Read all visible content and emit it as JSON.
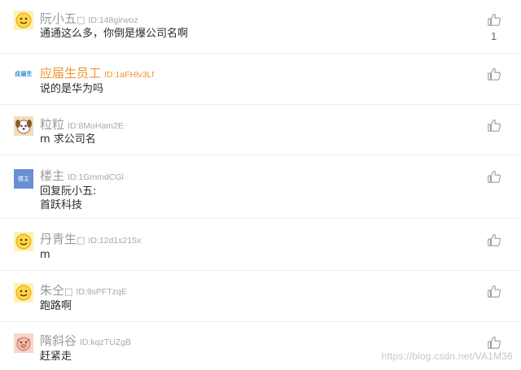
{
  "comments": [
    {
      "name": "阮小五",
      "name_suffix": "□",
      "id": "ID:148girwoz",
      "text": "通通这么多，你倒是爆公司名啊",
      "likes": "1",
      "avatar": "emoji-face-icon"
    },
    {
      "name": "应届生员工",
      "name_suffix": "",
      "id": "ID:1aFHlv3Lf",
      "text": "说的是华为吗",
      "likes": "",
      "avatar": "yingjiesheng-logo",
      "logo_text": "应届生"
    },
    {
      "name": "粒粒",
      "name_suffix": "",
      "id": "ID:8MoHam2E",
      "text": "m 求公司名",
      "likes": "",
      "avatar": "dog-face-icon"
    },
    {
      "name": "楼主",
      "name_suffix": "",
      "id": "ID:1GmmdCGl",
      "text_lines": [
        "回复阮小五:",
        "首跃科技"
      ],
      "likes": "",
      "avatar": "louzhu-badge",
      "badge_text": "楼主"
    },
    {
      "name": "丹青生",
      "name_suffix": "□",
      "id": "ID:12d1s215x",
      "text": "m",
      "likes": "",
      "avatar": "emoji-face-icon"
    },
    {
      "name": "朱仝",
      "name_suffix": "□",
      "id": "ID:9sPFTzqE",
      "text": "跑路啊",
      "likes": "",
      "avatar": "emoji-face-icon"
    },
    {
      "name": "隋斜谷",
      "name_suffix": "",
      "id": "ID:kqzTUZgB",
      "text": "赶紧走",
      "likes": "",
      "avatar": "pig-face-icon"
    }
  ],
  "watermark": "https://blog.csdn.net/VA1M36",
  "colors": {
    "name_gray": "#9a9a9a",
    "name_orange": "#f0952b",
    "divider": "#ececec",
    "avatar_blue": "#6a8fd2"
  }
}
